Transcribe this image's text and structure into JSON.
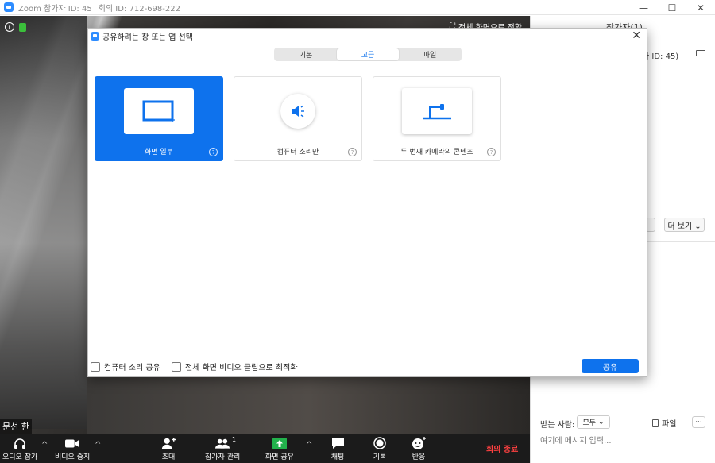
{
  "window": {
    "title": "Zoom 참가자 ID: 45",
    "meeting_id": "회의 ID: 712-698-222",
    "minimize": "—",
    "maximize": "☐",
    "close": "✕"
  },
  "video": {
    "fullscreen_label": "전체 화면으로 전환",
    "participant_name": "문선 한"
  },
  "panel": {
    "title": "참가자(1)",
    "participant_id": "자 ID: 45)",
    "more_label": "더 보기 ⌄",
    "chat_to_label": "받는 사람:",
    "chat_to_value": "모두",
    "file_label": "파일",
    "dots_label": "···",
    "chat_placeholder": "여기에 메시지 입력..."
  },
  "toolbar": {
    "audio": "오디오 참가",
    "video": "비디오 중지",
    "invite": "초대",
    "participants": "참가자 관리",
    "participants_count": "1",
    "share": "화면 공유",
    "chat": "채팅",
    "record": "기록",
    "reactions": "반응",
    "end": "회의 종료",
    "caret": "^"
  },
  "dialog": {
    "title": "공유하려는 창 또는 앱 선택",
    "close": "✕",
    "tabs": [
      {
        "label": "기본",
        "active": false
      },
      {
        "label": "고급",
        "active": true
      },
      {
        "label": "파일",
        "active": false
      }
    ],
    "cards": [
      {
        "label": "화면 일부",
        "icon": "screen-portion-icon",
        "selected": true
      },
      {
        "label": "컴퓨터 소리만",
        "icon": "speaker-icon",
        "selected": false
      },
      {
        "label": "두 번째 카메라의 콘텐츠",
        "icon": "document-camera-icon",
        "selected": false
      }
    ],
    "help_glyph": "?",
    "share_audio_label": "컴퓨터 소리 공유",
    "optimize_label": "전체 화면 비디오 클립으로 최적화",
    "share_button": "공유"
  },
  "colors": {
    "accent": "#0e72ed",
    "end_meeting": "#ff4040",
    "toolbar_bg": "#1b1b1b",
    "share_green": "#22b24c"
  }
}
